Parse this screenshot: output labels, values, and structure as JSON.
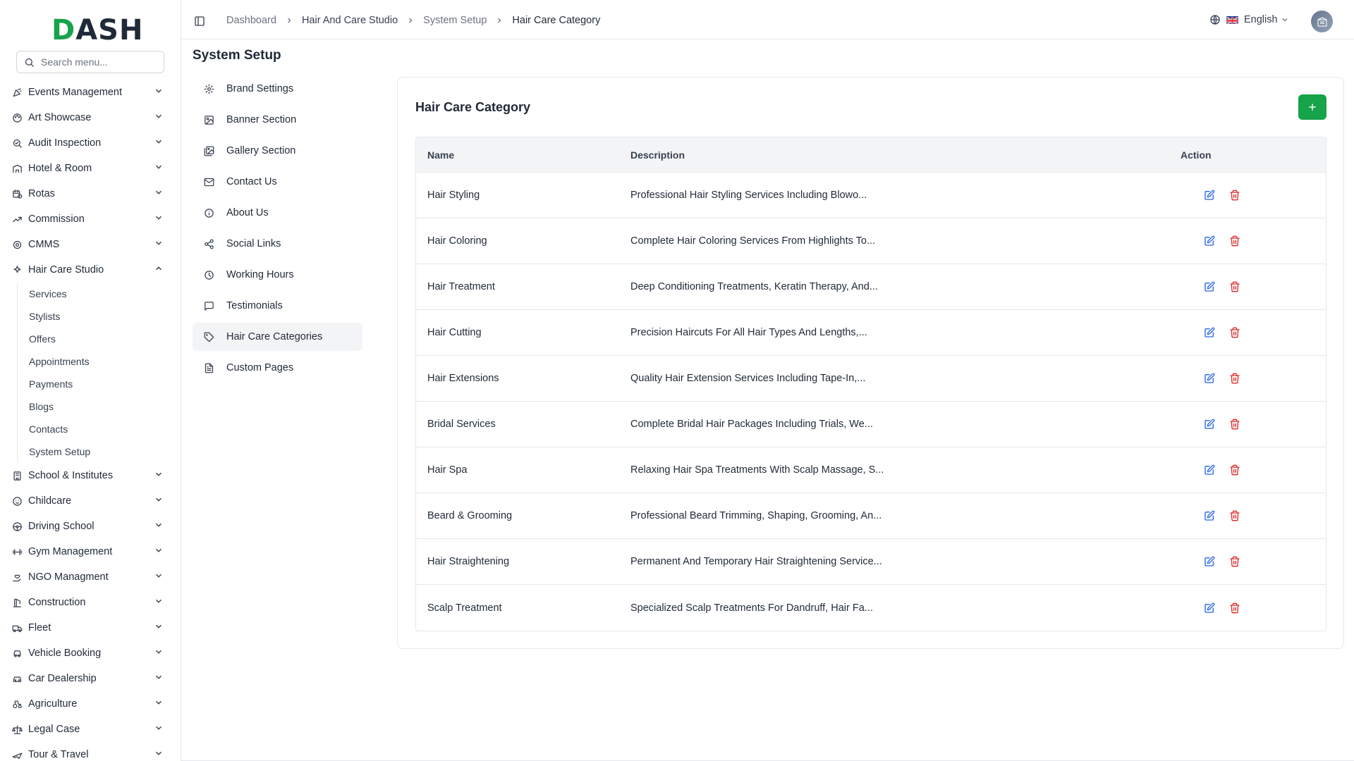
{
  "brand": {
    "logo_prefix": "D",
    "logo_rest": "ASH",
    "accent": "#16a34a"
  },
  "search": {
    "placeholder": "Search menu..."
  },
  "sidebar": {
    "items": [
      {
        "label": "Events Management",
        "icon": "party-icon"
      },
      {
        "label": "Art Showcase",
        "icon": "palette-icon"
      },
      {
        "label": "Audit Inspection",
        "icon": "search-check-icon"
      },
      {
        "label": "Hotel & Room",
        "icon": "hotel-icon"
      },
      {
        "label": "Rotas",
        "icon": "calendar-clock-icon"
      },
      {
        "label": "Commission",
        "icon": "trending-up-icon"
      },
      {
        "label": "CMMS",
        "icon": "cog-icon"
      },
      {
        "label": "Hair Care Studio",
        "icon": "sparkles-icon",
        "expanded": true,
        "children": [
          "Services",
          "Stylists",
          "Offers",
          "Appointments",
          "Payments",
          "Blogs",
          "Contacts",
          "System Setup"
        ]
      },
      {
        "label": "School & Institutes",
        "icon": "building-icon"
      },
      {
        "label": "Childcare",
        "icon": "baby-icon"
      },
      {
        "label": "Driving School",
        "icon": "steering-wheel-icon"
      },
      {
        "label": "Gym Management",
        "icon": "dumbbell-icon"
      },
      {
        "label": "NGO Managment",
        "icon": "hand-heart-icon"
      },
      {
        "label": "Construction",
        "icon": "crane-icon"
      },
      {
        "label": "Fleet",
        "icon": "truck-icon"
      },
      {
        "label": "Vehicle Booking",
        "icon": "car-icon"
      },
      {
        "label": "Car Dealership",
        "icon": "car-front-icon"
      },
      {
        "label": "Agriculture",
        "icon": "tractor-icon"
      },
      {
        "label": "Legal Case",
        "icon": "scale-icon"
      },
      {
        "label": "Tour & Travel",
        "icon": "plane-icon"
      }
    ]
  },
  "header": {
    "breadcrumb": [
      "Dashboard",
      "Hair And Care Studio",
      "System Setup",
      "Hair Care Category"
    ],
    "language": "English"
  },
  "page": {
    "title": "System Setup"
  },
  "setup_nav": [
    {
      "label": "Brand Settings",
      "icon": "settings-icon"
    },
    {
      "label": "Banner Section",
      "icon": "image-icon"
    },
    {
      "label": "Gallery Section",
      "icon": "images-icon"
    },
    {
      "label": "Contact Us",
      "icon": "mail-icon"
    },
    {
      "label": "About Us",
      "icon": "info-icon"
    },
    {
      "label": "Social Links",
      "icon": "share-icon"
    },
    {
      "label": "Working Hours",
      "icon": "clock-icon"
    },
    {
      "label": "Testimonials",
      "icon": "message-square-icon"
    },
    {
      "label": "Hair Care Categories",
      "icon": "tag-icon",
      "active": true
    },
    {
      "label": "Custom Pages",
      "icon": "file-text-icon"
    }
  ],
  "card": {
    "title": "Hair Care Category",
    "columns": {
      "name": "Name",
      "description": "Description",
      "action": "Action"
    },
    "rows": [
      {
        "name": "Hair Styling",
        "description": "Professional Hair Styling Services Including Blowo..."
      },
      {
        "name": "Hair Coloring",
        "description": "Complete Hair Coloring Services From Highlights To..."
      },
      {
        "name": "Hair Treatment",
        "description": "Deep Conditioning Treatments, Keratin Therapy, And..."
      },
      {
        "name": "Hair Cutting",
        "description": "Precision Haircuts For All Hair Types And Lengths,..."
      },
      {
        "name": "Hair Extensions",
        "description": "Quality Hair Extension Services Including Tape-In,..."
      },
      {
        "name": "Bridal Services",
        "description": "Complete Bridal Hair Packages Including Trials, We..."
      },
      {
        "name": "Hair Spa",
        "description": "Relaxing Hair Spa Treatments With Scalp Massage, S..."
      },
      {
        "name": "Beard & Grooming",
        "description": "Professional Beard Trimming, Shaping, Grooming, An..."
      },
      {
        "name": "Hair Straightening",
        "description": "Permanent And Temporary Hair Straightening Service..."
      },
      {
        "name": "Scalp Treatment",
        "description": "Specialized Scalp Treatments For Dandruff, Hair Fa..."
      }
    ]
  },
  "colors": {
    "edit": "#2563eb",
    "delete": "#dc2626",
    "active_bg": "#f3f4f6"
  }
}
